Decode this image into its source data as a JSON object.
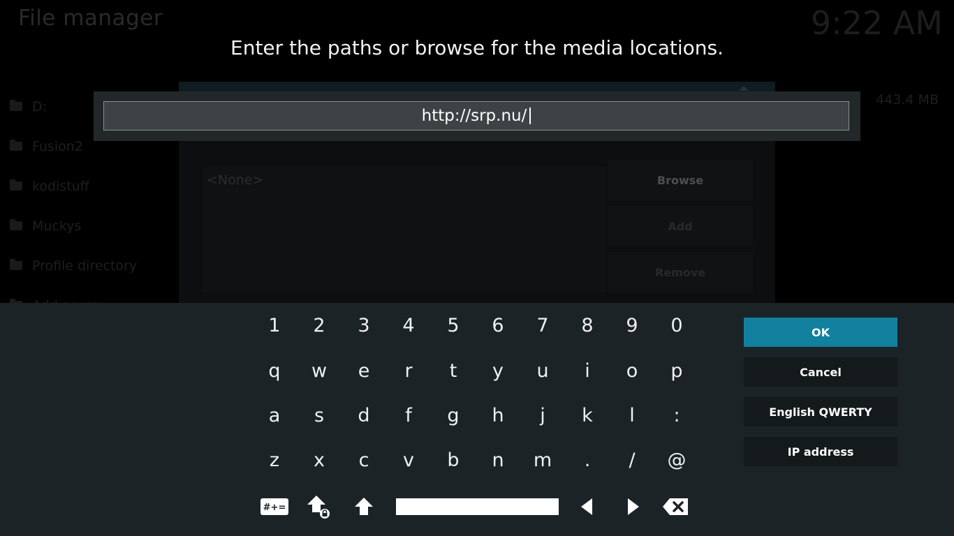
{
  "background": {
    "title": "File manager",
    "clock": "9:22 AM",
    "folders": [
      "D:",
      "Fusion2",
      "kodistuff",
      "Muckys",
      "Profile directory",
      "Add source"
    ],
    "size_label": "443.4 MB",
    "dialog": {
      "list_empty": "<None>",
      "buttons": [
        "Browse",
        "Add",
        "Remove"
      ]
    }
  },
  "prompt": "Enter the paths or browse for the media locations.",
  "input": {
    "value": "http://srp.nu/"
  },
  "keyboard": {
    "rows": [
      [
        "1",
        "2",
        "3",
        "4",
        "5",
        "6",
        "7",
        "8",
        "9",
        "0"
      ],
      [
        "q",
        "w",
        "e",
        "r",
        "t",
        "y",
        "u",
        "i",
        "o",
        "p"
      ],
      [
        "a",
        "s",
        "d",
        "f",
        "g",
        "h",
        "j",
        "k",
        "l",
        ":"
      ],
      [
        "z",
        "x",
        "c",
        "v",
        "b",
        "n",
        "m",
        ".",
        "/",
        "@"
      ]
    ],
    "special": [
      "symbols-icon",
      "caps-lock-icon",
      "shift-icon",
      "space-bar",
      "arrow-left-icon",
      "arrow-right-icon",
      "backspace-icon"
    ]
  },
  "side_buttons": {
    "ok": "OK",
    "cancel": "Cancel",
    "layout": "English QWERTY",
    "ip": "IP address"
  },
  "colors": {
    "accent": "#12809f",
    "panel": "#1b2326",
    "input_bg": "#3d4244"
  }
}
